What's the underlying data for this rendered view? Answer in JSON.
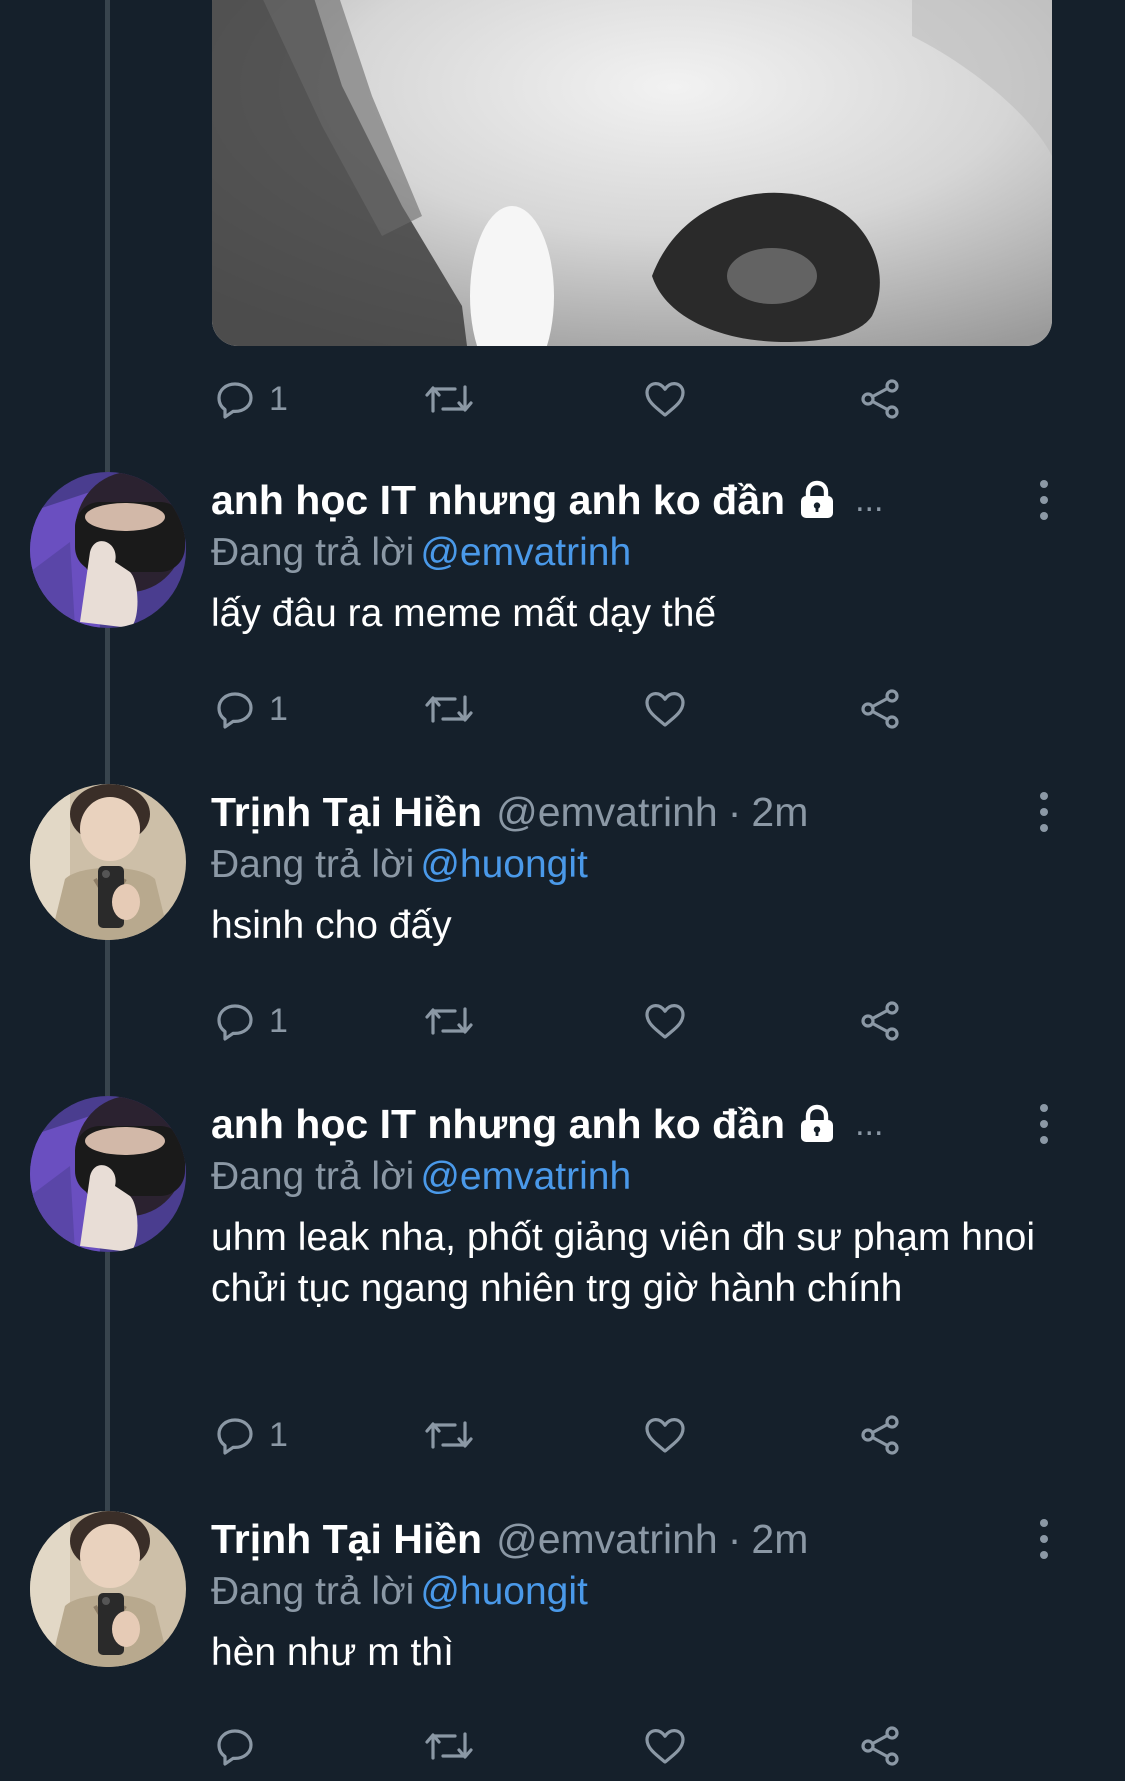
{
  "top_media": {
    "actions": {
      "reply_count": "1"
    }
  },
  "tweets": [
    {
      "display_name": "anh học IT nhưng anh ko đần",
      "ellipsis": "...",
      "reply_prefix": "Đang trả lời",
      "reply_to": "@emvatrinh",
      "text": "lấy đâu ra meme mất dạy thế",
      "reply_count": "1"
    },
    {
      "display_name": "Trịnh Tại Hiền",
      "handle": "@emvatrinh",
      "separator": "·",
      "time": "2m",
      "reply_prefix": "Đang trả lời",
      "reply_to": "@huongit",
      "text": "hsinh cho đấy",
      "reply_count": "1"
    },
    {
      "display_name": "anh học IT nhưng anh ko đần",
      "ellipsis": "...",
      "reply_prefix": "Đang trả lời",
      "reply_to": "@emvatrinh",
      "text": "uhm leak nha, phốt giảng viên đh sư phạm hnoi chửi tục ngang nhiên trg giờ hành chính",
      "reply_count": "1"
    },
    {
      "display_name": "Trịnh Tại Hiền",
      "handle": "@emvatrinh",
      "separator": "·",
      "time": "2m",
      "reply_prefix": "Đang trả lời",
      "reply_to": "@huongit",
      "text": "hèn như m thì",
      "reply_count": ""
    }
  ],
  "icons": {
    "reply": "reply-bubble-icon",
    "retweet": "retweet-icon",
    "like": "heart-icon",
    "share": "share-icon",
    "more": "vertical-dots-icon",
    "protected": "lock-icon"
  },
  "colors": {
    "background": "#15202b",
    "muted_text": "#8b98a5",
    "mention": "#4a99e9",
    "thread_line": "#38444d"
  }
}
